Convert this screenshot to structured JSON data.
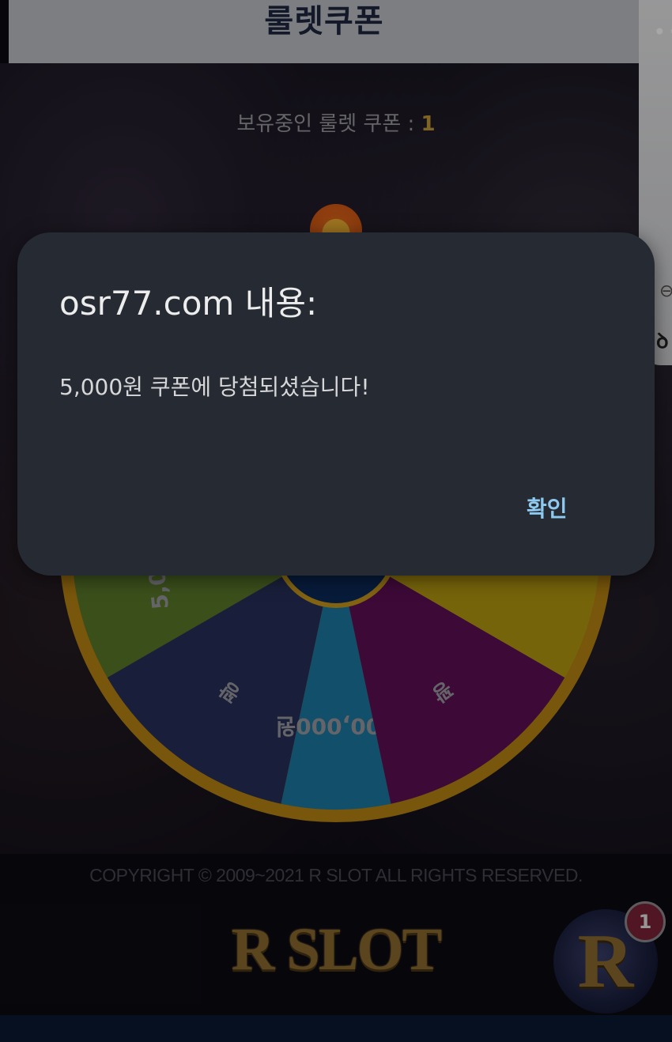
{
  "header": {
    "title": "룰렛쿠폰"
  },
  "coupon": {
    "label": "보유중인 룰렛 쿠폰 : ",
    "count": "1"
  },
  "wheel": {
    "segments": [
      {
        "label": "5,000원",
        "color": "#5b7a2a"
      },
      {
        "label": "꽝",
        "color": "#27315a"
      },
      {
        "label": "100,000원",
        "color": "#1b7aa3"
      },
      {
        "label": "꽝",
        "color": "#5e0f55"
      },
      {
        "label": "",
        "color": "#b59a12"
      }
    ],
    "rim_color": "#b88512"
  },
  "footer": {
    "copyright": "COPYRIGHT © 2009~2021 R SLOT ALL RIGHTS RESERVED.",
    "logo": "R SLOT"
  },
  "fab": {
    "letter": "R",
    "badge": "1"
  },
  "side_widget": {
    "dots": "••",
    "mini": "⊖",
    "bottom": "ꝺ"
  },
  "dialog": {
    "title": "osr77.com 내용:",
    "message": "5,000원 쿠폰에 당첨되셨습니다!",
    "ok_label": "확인",
    "accent": "#8ec9ef"
  }
}
